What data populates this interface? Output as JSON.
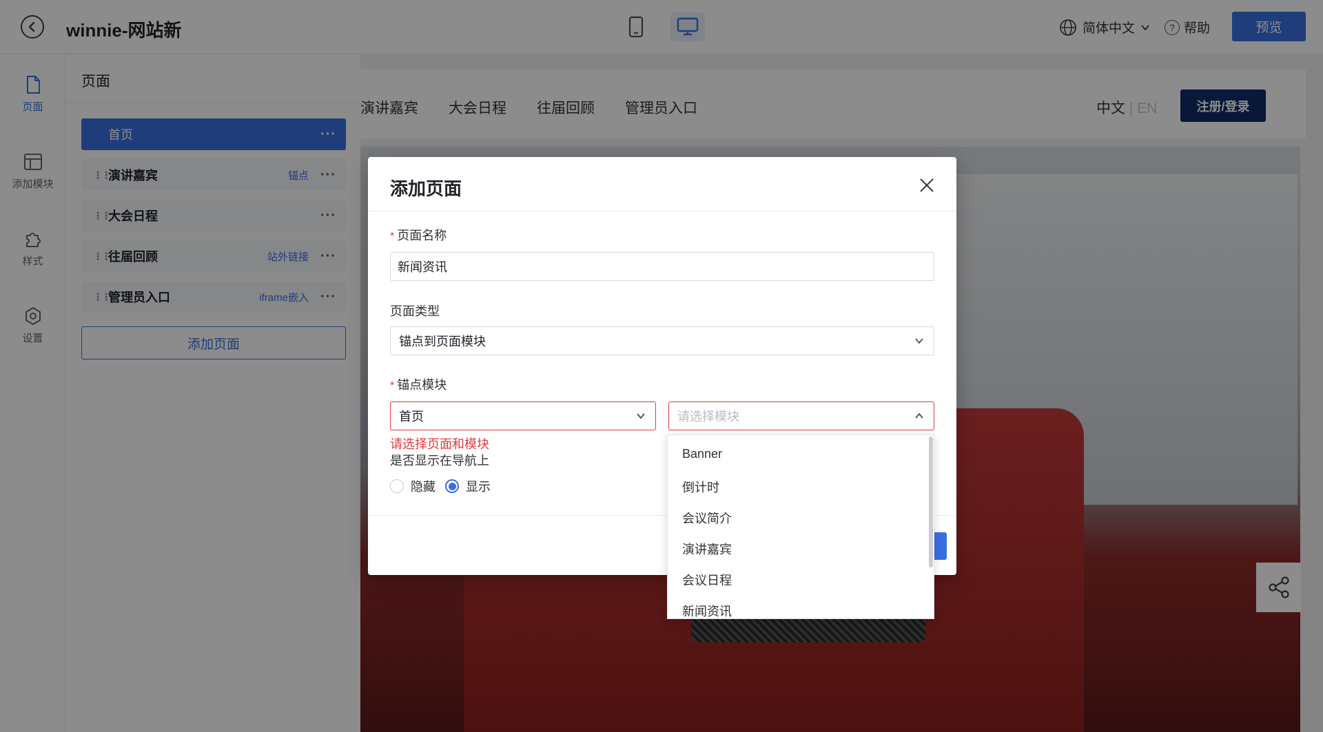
{
  "topbar": {
    "title": "winnie-网站新",
    "language": "简体中文",
    "help": "帮助",
    "preview": "预览"
  },
  "rail": {
    "items": [
      {
        "label": "页面",
        "icon": "file-icon"
      },
      {
        "label": "添加模块",
        "icon": "layout-icon"
      },
      {
        "label": "样式",
        "icon": "puzzle-icon"
      },
      {
        "label": "设置",
        "icon": "gear-icon"
      }
    ]
  },
  "panel": {
    "title": "页面",
    "pages": [
      {
        "label": "首页",
        "tag": ""
      },
      {
        "label": "演讲嘉宾",
        "tag": "锚点"
      },
      {
        "label": "大会日程",
        "tag": ""
      },
      {
        "label": "往届回顾",
        "tag": "站外链接"
      },
      {
        "label": "管理员入口",
        "tag": "iframe嵌入"
      }
    ],
    "add_button": "添加页面"
  },
  "site": {
    "nav": [
      "演讲嘉宾",
      "大会日程",
      "往届回顾",
      "管理员入口"
    ],
    "lang_zh": "中文",
    "lang_sep": "|",
    "lang_en": "EN",
    "login": "注册/登录"
  },
  "modal": {
    "title": "添加页面",
    "name_label": "页面名称",
    "name_value": "新闻资讯",
    "type_label": "页面类型",
    "type_value": "锚点到页面模块",
    "anchor_label": "锚点模块",
    "page_select": "首页",
    "module_placeholder": "请选择模块",
    "error": "请选择页面和模块",
    "nav_label": "是否显示在导航上",
    "radio_hide": "隐藏",
    "radio_show": "显示",
    "radio_selected": "显示"
  },
  "dropdown": {
    "options": [
      "Banner",
      "倒计时",
      "会议简介",
      "演讲嘉宾",
      "会议日程",
      "新闻资讯"
    ]
  },
  "colors": {
    "accent": "#3a6fe0",
    "error": "#e4393c",
    "login": "#0e2c66"
  }
}
